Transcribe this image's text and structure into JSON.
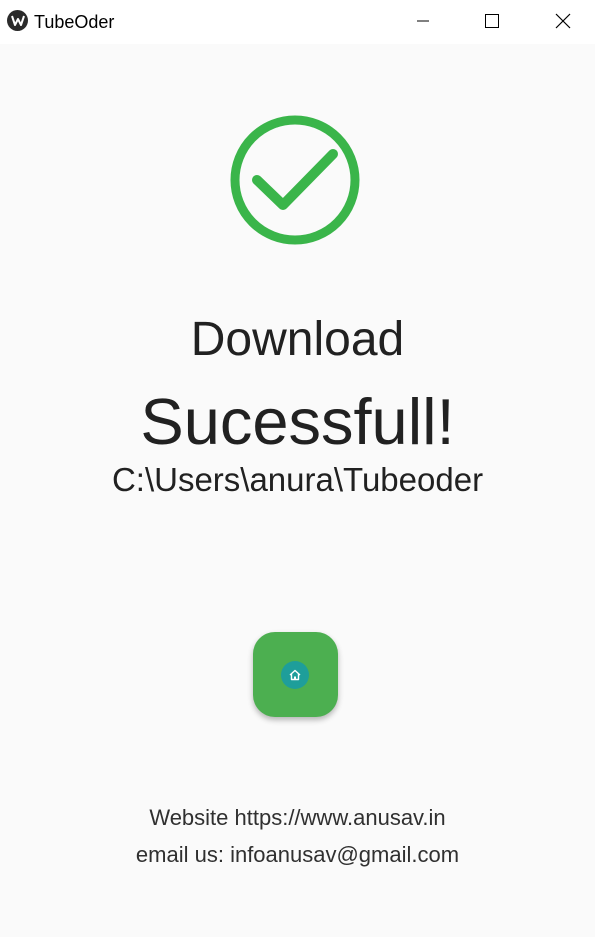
{
  "window": {
    "title": "TubeOder",
    "controls": [
      "minimize-icon",
      "maximize-icon",
      "close-icon"
    ]
  },
  "status": {
    "icon": "check-circle-icon",
    "icon_color": "#3ab54a",
    "line1": "Download",
    "line2": "Sucessfull!",
    "path": "C:\\Users\\anura\\Tubeoder"
  },
  "home_button": {
    "icon": "home-icon",
    "color": "#4caf50",
    "badge_color": "#1e9e9a"
  },
  "footer": {
    "website": "Website https://www.anusav.in",
    "email": "email us: infoanusav@gmail.com"
  }
}
